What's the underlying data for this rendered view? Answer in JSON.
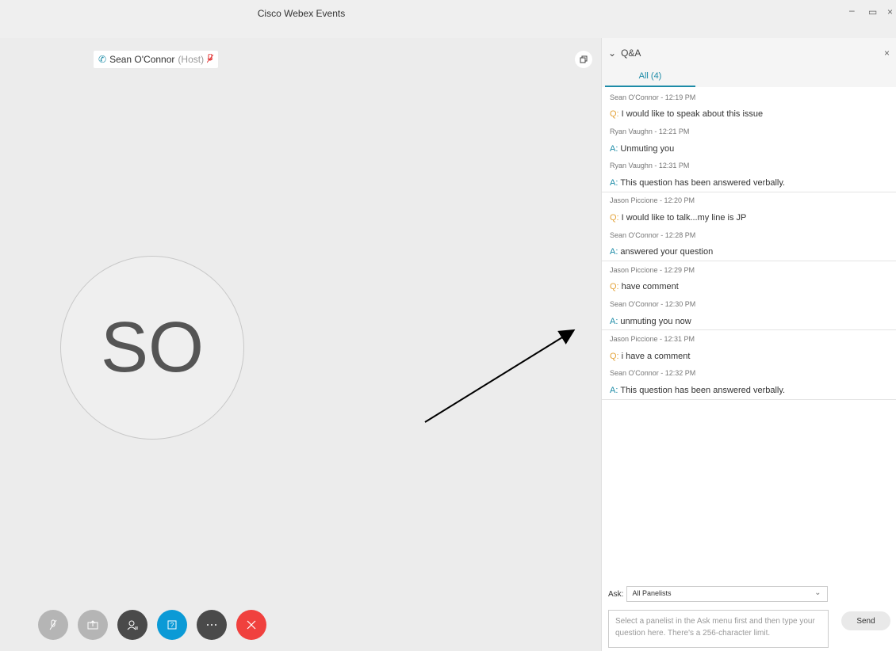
{
  "window": {
    "title": "Cisco Webex Events",
    "minimize": "–",
    "restore": "▭",
    "close": "×"
  },
  "stage": {
    "presenter_name": "Sean O'Connor",
    "presenter_role": "(Host)",
    "avatar_initials": "SO"
  },
  "panel": {
    "title": "Q&A",
    "close": "×",
    "tab_all": "All (4)",
    "entries": [
      {
        "lines": [
          {
            "type": "meta",
            "text": "Sean O'Connor - 12:19 PM"
          },
          {
            "type": "q",
            "prefix": "Q:",
            "text": "I would like to speak about this issue"
          },
          {
            "type": "meta",
            "text": "Ryan Vaughn - 12:21 PM"
          },
          {
            "type": "a",
            "prefix": "A:",
            "text": "Unmuting you"
          },
          {
            "type": "meta",
            "text": "Ryan Vaughn - 12:31 PM"
          },
          {
            "type": "a",
            "prefix": "A:",
            "text": "This question has been answered verbally."
          }
        ]
      },
      {
        "lines": [
          {
            "type": "meta",
            "text": "Jason Piccione - 12:20 PM"
          },
          {
            "type": "q",
            "prefix": "Q:",
            "text": "I would like to talk...my line is JP"
          },
          {
            "type": "meta",
            "text": "Sean O'Connor - 12:28 PM"
          },
          {
            "type": "a",
            "prefix": "A:",
            "text": "answered your question"
          }
        ]
      },
      {
        "lines": [
          {
            "type": "meta",
            "text": "Jason Piccione - 12:29 PM"
          },
          {
            "type": "q",
            "prefix": "Q:",
            "text": "have comment"
          },
          {
            "type": "meta",
            "text": "Sean O'Connor - 12:30 PM"
          },
          {
            "type": "a",
            "prefix": "A:",
            "text": "unmuting you now"
          }
        ]
      },
      {
        "lines": [
          {
            "type": "meta",
            "text": "Jason Piccione - 12:31 PM"
          },
          {
            "type": "q",
            "prefix": "Q:",
            "text": "i have a comment"
          },
          {
            "type": "meta",
            "text": "Sean O'Connor - 12:32 PM"
          },
          {
            "type": "a",
            "prefix": "A:",
            "text": "This question has been answered verbally."
          }
        ]
      }
    ],
    "ask_label": "Ask:",
    "ask_selected": "All Panelists",
    "ask_placeholder": "Select a panelist in the Ask menu first and then type your question here. There's a 256-character limit.",
    "send_label": "Send"
  },
  "colors": {
    "accent": "#1c8ba7",
    "question": "#e3a33a",
    "end_call": "#f0413e",
    "qa_button": "#0b9ad6"
  },
  "icons": [
    "phone-icon",
    "muted-mic-icon",
    "popout-icon",
    "mute-icon",
    "share-icon",
    "participants-icon",
    "qa-icon",
    "more-icon",
    "end-call-icon",
    "chevron-down-icon"
  ]
}
